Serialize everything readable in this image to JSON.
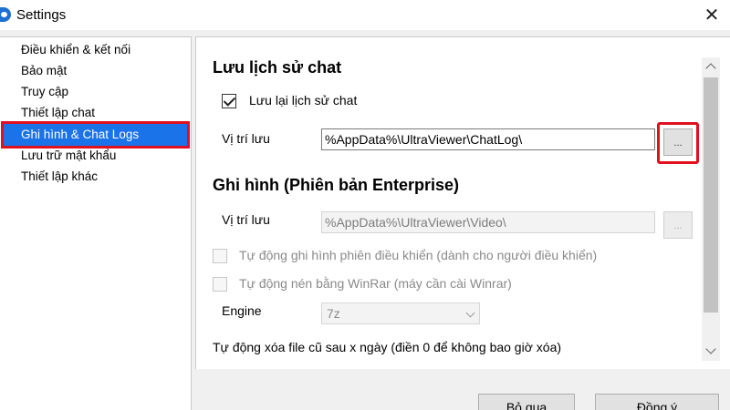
{
  "window": {
    "title": "Settings",
    "close_glyph": "✕",
    "app_icon": "ultraviewer-logo-icon"
  },
  "sidebar": {
    "items": [
      {
        "label": "Điều khiển & kết nối",
        "selected": false
      },
      {
        "label": "Bảo mật",
        "selected": false
      },
      {
        "label": "Truy cập",
        "selected": false
      },
      {
        "label": "Thiết lập chat",
        "selected": false
      },
      {
        "label": "Ghi hình & Chat Logs",
        "selected": true
      },
      {
        "label": "Lưu trữ mật khẩu",
        "selected": false
      },
      {
        "label": "Thiết lập khác",
        "selected": false
      }
    ]
  },
  "chat_log": {
    "title": "Lưu lịch sử chat",
    "save_checkbox_label": "Lưu lại lịch sử chat",
    "save_checked": true,
    "location_label": "Vị trí lưu",
    "location_value": "%AppData%\\UltraViewer\\ChatLog\\",
    "browse_label": "..."
  },
  "recording": {
    "title": "Ghi hình (Phiên bản Enterprise)",
    "location_label": "Vị trí lưu",
    "location_value": "%AppData%\\UltraViewer\\Video\\",
    "browse_label": "...",
    "auto_record_label": "Tự động ghi hình phiên điều khiển (dành cho người điều khiển)",
    "auto_compress_label": "Tự động nén bằng WinRar (máy cần cài Winrar)",
    "engine_label": "Engine",
    "engine_value": "7z",
    "auto_delete_label": "Tự động xóa file cũ sau x ngày (điền 0 để không bao giờ xóa)"
  },
  "footer": {
    "cancel_label": "Bỏ qua",
    "ok_label": "Đồng ý"
  },
  "colors": {
    "selection": "#1a73e8",
    "highlight": "#e01020"
  }
}
